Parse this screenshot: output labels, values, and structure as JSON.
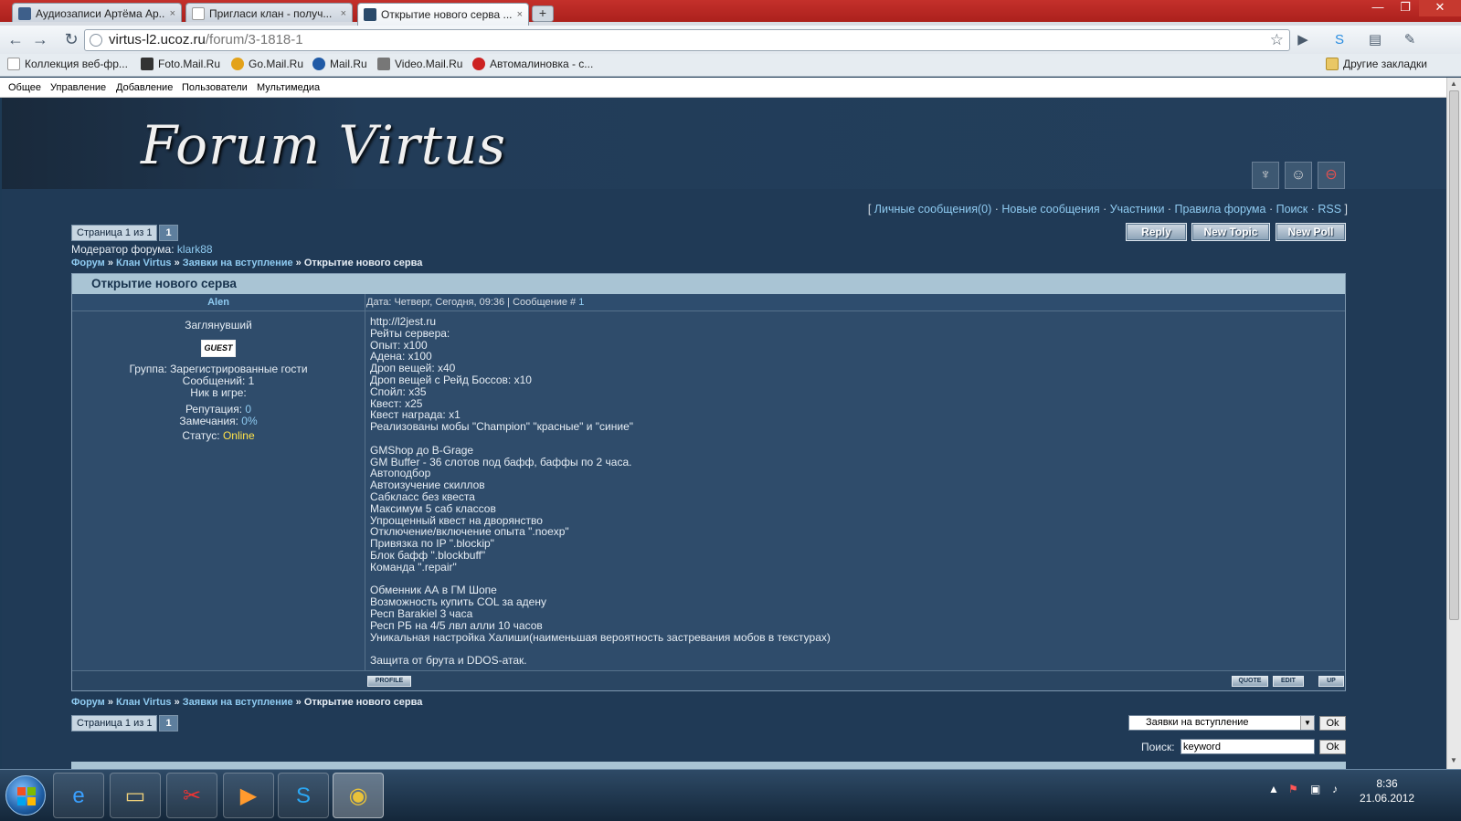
{
  "browser": {
    "tabs": [
      {
        "title": "Аудиозаписи Артёма Ар...",
        "close": "×",
        "favicon_color": "#3e5f8a"
      },
      {
        "title": "Пригласи клан - получ...",
        "close": "×",
        "favicon_color": "#ffffff"
      },
      {
        "title": "Открытие нового серва ...",
        "close": "×",
        "favicon_color": "#2a4a6a"
      }
    ],
    "new_tab_label": "+",
    "window_controls": {
      "minimize": "—",
      "maximize": "❐",
      "close": "✕"
    },
    "url_host": "virtus-l2.ucoz.ru",
    "url_path": "/forum/3-1818-1",
    "bookmarks": [
      {
        "label": "Коллекция веб-фр...",
        "icon_color": "#ffffff"
      },
      {
        "label": "Foto.Mail.Ru",
        "icon_color": "#333333"
      },
      {
        "label": "Go.Mail.Ru",
        "icon_color": "#e3a21a"
      },
      {
        "label": "Mail.Ru",
        "icon_color": "#1f5aa6"
      },
      {
        "label": "Video.Mail.Ru",
        "icon_color": "#777777"
      },
      {
        "label": "Автомалиновка - с...",
        "icon_color": "#cc2222"
      }
    ],
    "other_bookmarks": "Другие закладки"
  },
  "adminbar": {
    "items": [
      "Общее",
      "Управление",
      "Добавление",
      "Пользователи",
      "Мультимедиа"
    ]
  },
  "forum": {
    "logo": "Forum Virtus",
    "header_icons": [
      "crest-icon",
      "avatar-icon",
      "logout-icon"
    ],
    "top_links": {
      "open_bracket": "[ ",
      "close_bracket": " ]",
      "sep": " · ",
      "items": [
        "Личные сообщения(0)",
        "Новые сообщения",
        "Участники",
        "Правила форума",
        "Поиск",
        "RSS"
      ]
    },
    "pager": {
      "label": "Страница 1 из 1",
      "page": "1"
    },
    "moderator_label": "Модератор форума:",
    "moderator_name": "klark88",
    "buttons": {
      "reply": "Reply",
      "new_topic": "New Topic",
      "new_poll": "New Poll"
    },
    "breadcrumb": {
      "items": [
        "Форум",
        "Клан Virtus",
        "Заявки на вступление"
      ],
      "sep": " » ",
      "current": "Открытие нового серва"
    },
    "post": {
      "thread_title": "Открытие нового серва",
      "author": "Alen",
      "meta_text": "Дата: Четверг, Сегодня, 09:36 | Сообщение # ",
      "meta_num": "1",
      "rank": "Заглянувший",
      "badge": "GUEST",
      "group": "Группа: Зарегистрированные гости",
      "messages": "Сообщений: 1",
      "nick": "Ник в игре:",
      "rep_label": "Репутация: ",
      "rep_value": "0",
      "warn_label": "Замечания: ",
      "warn_value": "0%",
      "status_label": "Статус: ",
      "status_value": "Online",
      "body": "http://l2jest.ru\nРейты сервера:\nОпыт: x100\nАдена: x100\nДроп вещей: x40\nДроп вещей с Рейд Боссов: x10\nСпойл: x35\nКвест: x25\nКвест награда: x1\nРеализованы мобы \"Champion\" \"красные\" и \"синие\"\n\nGMShop до B-Grage\nGM Buffer - 36 слотов под бафф, баффы по 2 часа.\nАвтоподбор\nАвтоизучение скиллов\nСабкласс без квеста\nМаксимум 5 саб классов\nУпрощенный квест на дворянство\nОтключение/включение опыта \".noexp\"\nПривязка по IP \".blockip\"\nБлок бафф \".blockbuff\"\nКоманда \".repair\"\n\nОбменник АА в ГМ Шопе\nВозможность купить COL за адену\nРесп Barakiel 3 часа\nРесп РБ на 4/5 лвл алли 10 часов\nУникальная настройка Халиши(наименьшая вероятность застревания мобов в текстурах)\n\nЗащита от брута и DDOS-атак.",
      "foot_buttons": {
        "profile": "PROFILE",
        "quote": "QUOTE",
        "edit": "EDIT",
        "up": "UP"
      }
    },
    "jump_select": "Заявки на вступление",
    "ok_label": "Ok",
    "search_label": "Поиск:",
    "search_value": "keyword"
  },
  "taskbar": {
    "apps": [
      "ie-icon",
      "explorer-icon",
      "paint-icon",
      "media-player-icon",
      "skype-icon",
      "chrome-icon"
    ],
    "clock_time": "8:36",
    "clock_date": "21.06.2012"
  }
}
